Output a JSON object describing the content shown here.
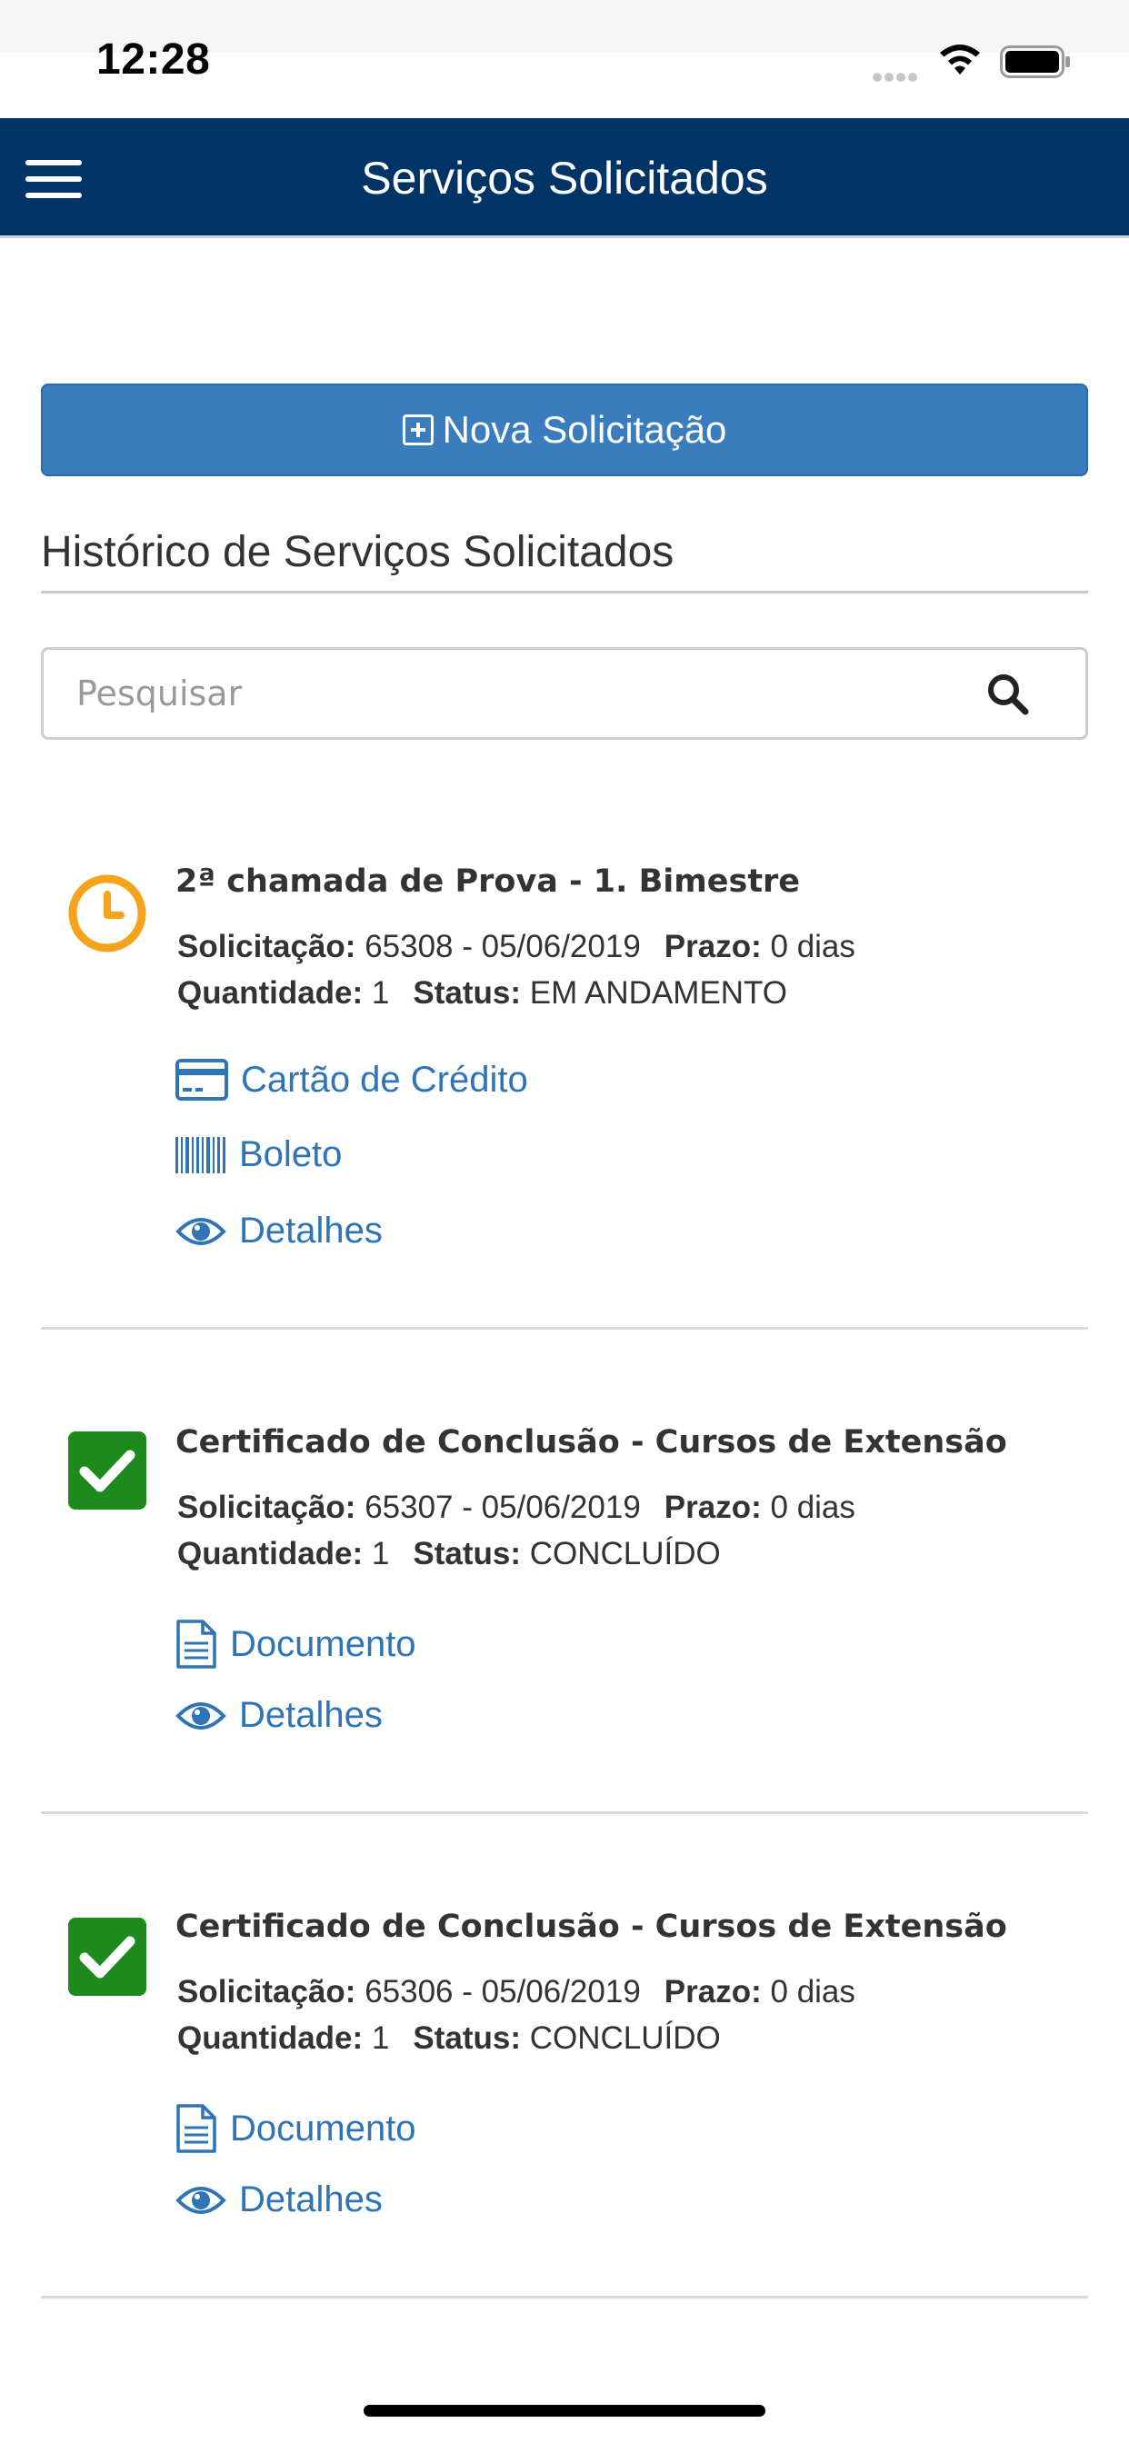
{
  "status_bar": {
    "time": "12:28"
  },
  "header": {
    "title": "Serviços Solicitados"
  },
  "new_request": {
    "label": "Nova Solicitação"
  },
  "history": {
    "title": "Histórico de Serviços Solicitados"
  },
  "search": {
    "placeholder": "Pesquisar"
  },
  "labels": {
    "solicitacao": "Solicitação:",
    "prazo": "Prazo:",
    "quantidade": "Quantidade:",
    "status": "Status:"
  },
  "requests": [
    {
      "title": "2ª chamada de Prova - 1. Bimestre",
      "solicitacao": "65308 - 05/06/2019",
      "prazo": "0 dias",
      "quantidade": "1",
      "status": "EM ANDAMENTO",
      "status_icon": "clock-icon",
      "actions": [
        "Cartão de Crédito",
        "Boleto",
        "Detalhes"
      ]
    },
    {
      "title": "Certificado de Conclusão - Cursos de Extensão",
      "solicitacao": "65307 - 05/06/2019",
      "prazo": "0 dias",
      "quantidade": "1",
      "status": "CONCLUÍDO",
      "status_icon": "check-icon",
      "actions": [
        "Documento",
        "Detalhes"
      ]
    },
    {
      "title": "Certificado de Conclusão - Cursos de Extensão",
      "solicitacao": "65306 - 05/06/2019",
      "prazo": "0 dias",
      "quantidade": "1",
      "status": "CONCLUÍDO",
      "status_icon": "check-icon",
      "actions": [
        "Documento",
        "Detalhes"
      ]
    }
  ],
  "colors": {
    "header_bg": "#003366",
    "button_bg": "#3a7dbf",
    "link": "#2f74b5",
    "pending": "#f5a31a",
    "done": "#1e8a1e"
  }
}
